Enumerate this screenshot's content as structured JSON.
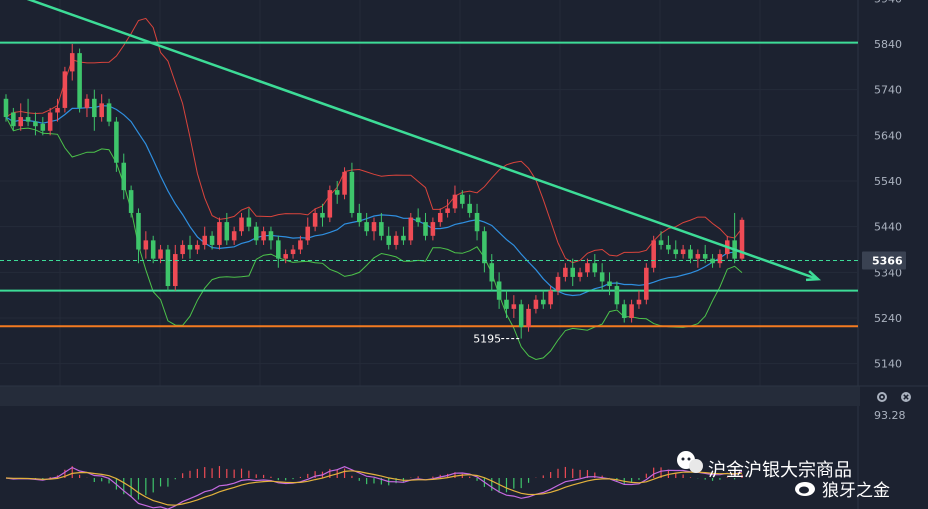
{
  "chart_data": {
    "type": "candlestick",
    "price_axis": {
      "ticks": [
        5940,
        5840,
        5740,
        5640,
        5540,
        5440,
        5340,
        5240,
        5140
      ],
      "ylim": [
        5100,
        5960
      ],
      "grid": true
    },
    "current_price": {
      "label": "5366",
      "value": 5366
    },
    "low_annotation": {
      "label": "5195",
      "value": 5195
    },
    "horizontal_levels": [
      {
        "name": "resistance",
        "value": 5843,
        "color": "#3ddc97"
      },
      {
        "name": "support",
        "value": 5300,
        "color": "#3ddc97"
      },
      {
        "name": "floor",
        "value": 5222,
        "color": "#f47b20"
      }
    ],
    "trendline": {
      "from": [
        0,
        5960
      ],
      "to": [
        125,
        5325
      ],
      "color": "#3ddc97",
      "arrow": true
    },
    "candles": [
      [
        5720,
        5730,
        5680,
        5670
      ],
      [
        5690,
        5700,
        5660,
        5650
      ],
      [
        5660,
        5710,
        5680,
        5650
      ],
      [
        5680,
        5720,
        5670,
        5660
      ],
      [
        5670,
        5690,
        5660,
        5640
      ],
      [
        5665,
        5680,
        5650,
        5640
      ],
      [
        5650,
        5700,
        5690,
        5640
      ],
      [
        5690,
        5720,
        5700,
        5670
      ],
      [
        5700,
        5790,
        5780,
        5690
      ],
      [
        5780,
        5840,
        5820,
        5760
      ],
      [
        5820,
        5830,
        5700,
        5690
      ],
      [
        5700,
        5730,
        5720,
        5680
      ],
      [
        5720,
        5740,
        5680,
        5650
      ],
      [
        5680,
        5730,
        5710,
        5670
      ],
      [
        5710,
        5720,
        5670,
        5660
      ],
      [
        5670,
        5680,
        5580,
        5560
      ],
      [
        5580,
        5600,
        5520,
        5500
      ],
      [
        5520,
        5530,
        5470,
        5460
      ],
      [
        5470,
        5480,
        5390,
        5360
      ],
      [
        5390,
        5430,
        5410,
        5370
      ],
      [
        5410,
        5420,
        5370,
        5360
      ],
      [
        5370,
        5400,
        5390,
        5360
      ],
      [
        5390,
        5400,
        5310,
        5300
      ],
      [
        5310,
        5400,
        5380,
        5300
      ],
      [
        5380,
        5410,
        5400,
        5370
      ],
      [
        5400,
        5420,
        5390,
        5370
      ],
      [
        5390,
        5410,
        5400,
        5380
      ],
      [
        5400,
        5440,
        5420,
        5390
      ],
      [
        5420,
        5430,
        5400,
        5390
      ],
      [
        5400,
        5460,
        5450,
        5390
      ],
      [
        5450,
        5470,
        5410,
        5400
      ],
      [
        5410,
        5440,
        5430,
        5400
      ],
      [
        5430,
        5470,
        5460,
        5420
      ],
      [
        5460,
        5480,
        5440,
        5430
      ],
      [
        5440,
        5450,
        5410,
        5400
      ],
      [
        5410,
        5440,
        5430,
        5400
      ],
      [
        5430,
        5440,
        5410,
        5390
      ],
      [
        5410,
        5420,
        5370,
        5350
      ],
      [
        5370,
        5390,
        5380,
        5360
      ],
      [
        5380,
        5400,
        5390,
        5370
      ],
      [
        5390,
        5420,
        5410,
        5380
      ],
      [
        5410,
        5460,
        5440,
        5400
      ],
      [
        5440,
        5480,
        5470,
        5430
      ],
      [
        5470,
        5490,
        5460,
        5440
      ],
      [
        5460,
        5530,
        5520,
        5450
      ],
      [
        5520,
        5540,
        5510,
        5490
      ],
      [
        5510,
        5570,
        5560,
        5500
      ],
      [
        5560,
        5580,
        5470,
        5460
      ],
      [
        5470,
        5490,
        5450,
        5440
      ],
      [
        5450,
        5470,
        5430,
        5420
      ],
      [
        5430,
        5460,
        5450,
        5410
      ],
      [
        5450,
        5470,
        5420,
        5410
      ],
      [
        5420,
        5440,
        5400,
        5390
      ],
      [
        5400,
        5430,
        5420,
        5390
      ],
      [
        5420,
        5440,
        5410,
        5400
      ],
      [
        5410,
        5470,
        5460,
        5400
      ],
      [
        5460,
        5480,
        5450,
        5440
      ],
      [
        5450,
        5470,
        5420,
        5410
      ],
      [
        5420,
        5460,
        5450,
        5410
      ],
      [
        5450,
        5480,
        5470,
        5440
      ],
      [
        5470,
        5500,
        5480,
        5460
      ],
      [
        5480,
        5530,
        5510,
        5470
      ],
      [
        5510,
        5520,
        5490,
        5480
      ],
      [
        5490,
        5510,
        5470,
        5460
      ],
      [
        5470,
        5490,
        5430,
        5410
      ],
      [
        5430,
        5440,
        5360,
        5340
      ],
      [
        5360,
        5380,
        5320,
        5300
      ],
      [
        5320,
        5340,
        5280,
        5260
      ],
      [
        5280,
        5300,
        5260,
        5240
      ],
      [
        5260,
        5290,
        5270,
        5240
      ],
      [
        5270,
        5280,
        5220,
        5195
      ],
      [
        5220,
        5270,
        5260,
        5210
      ],
      [
        5260,
        5290,
        5280,
        5250
      ],
      [
        5280,
        5300,
        5270,
        5260
      ],
      [
        5270,
        5310,
        5300,
        5260
      ],
      [
        5300,
        5340,
        5330,
        5290
      ],
      [
        5330,
        5360,
        5350,
        5320
      ],
      [
        5350,
        5370,
        5330,
        5310
      ],
      [
        5330,
        5350,
        5340,
        5320
      ],
      [
        5340,
        5370,
        5360,
        5330
      ],
      [
        5360,
        5380,
        5340,
        5330
      ],
      [
        5340,
        5360,
        5320,
        5300
      ],
      [
        5320,
        5340,
        5310,
        5290
      ],
      [
        5310,
        5320,
        5270,
        5260
      ],
      [
        5270,
        5280,
        5240,
        5230
      ],
      [
        5240,
        5280,
        5270,
        5230
      ],
      [
        5270,
        5300,
        5280,
        5260
      ],
      [
        5280,
        5360,
        5350,
        5270
      ],
      [
        5350,
        5420,
        5410,
        5340
      ],
      [
        5410,
        5430,
        5400,
        5390
      ],
      [
        5400,
        5420,
        5390,
        5380
      ],
      [
        5390,
        5410,
        5380,
        5370
      ],
      [
        5380,
        5400,
        5390,
        5370
      ],
      [
        5390,
        5400,
        5370,
        5360
      ],
      [
        5370,
        5390,
        5380,
        5350
      ],
      [
        5380,
        5400,
        5370,
        5360
      ],
      [
        5370,
        5380,
        5360,
        5350
      ],
      [
        5360,
        5390,
        5380,
        5350
      ],
      [
        5380,
        5420,
        5410,
        5370
      ],
      [
        5410,
        5470,
        5370,
        5360
      ],
      [
        5370,
        5460,
        5455,
        5365
      ]
    ],
    "indicator": {
      "value_label": "93.28"
    }
  },
  "watermark": {
    "account": "沪金沪银大宗商品",
    "author": "狼牙之金"
  }
}
